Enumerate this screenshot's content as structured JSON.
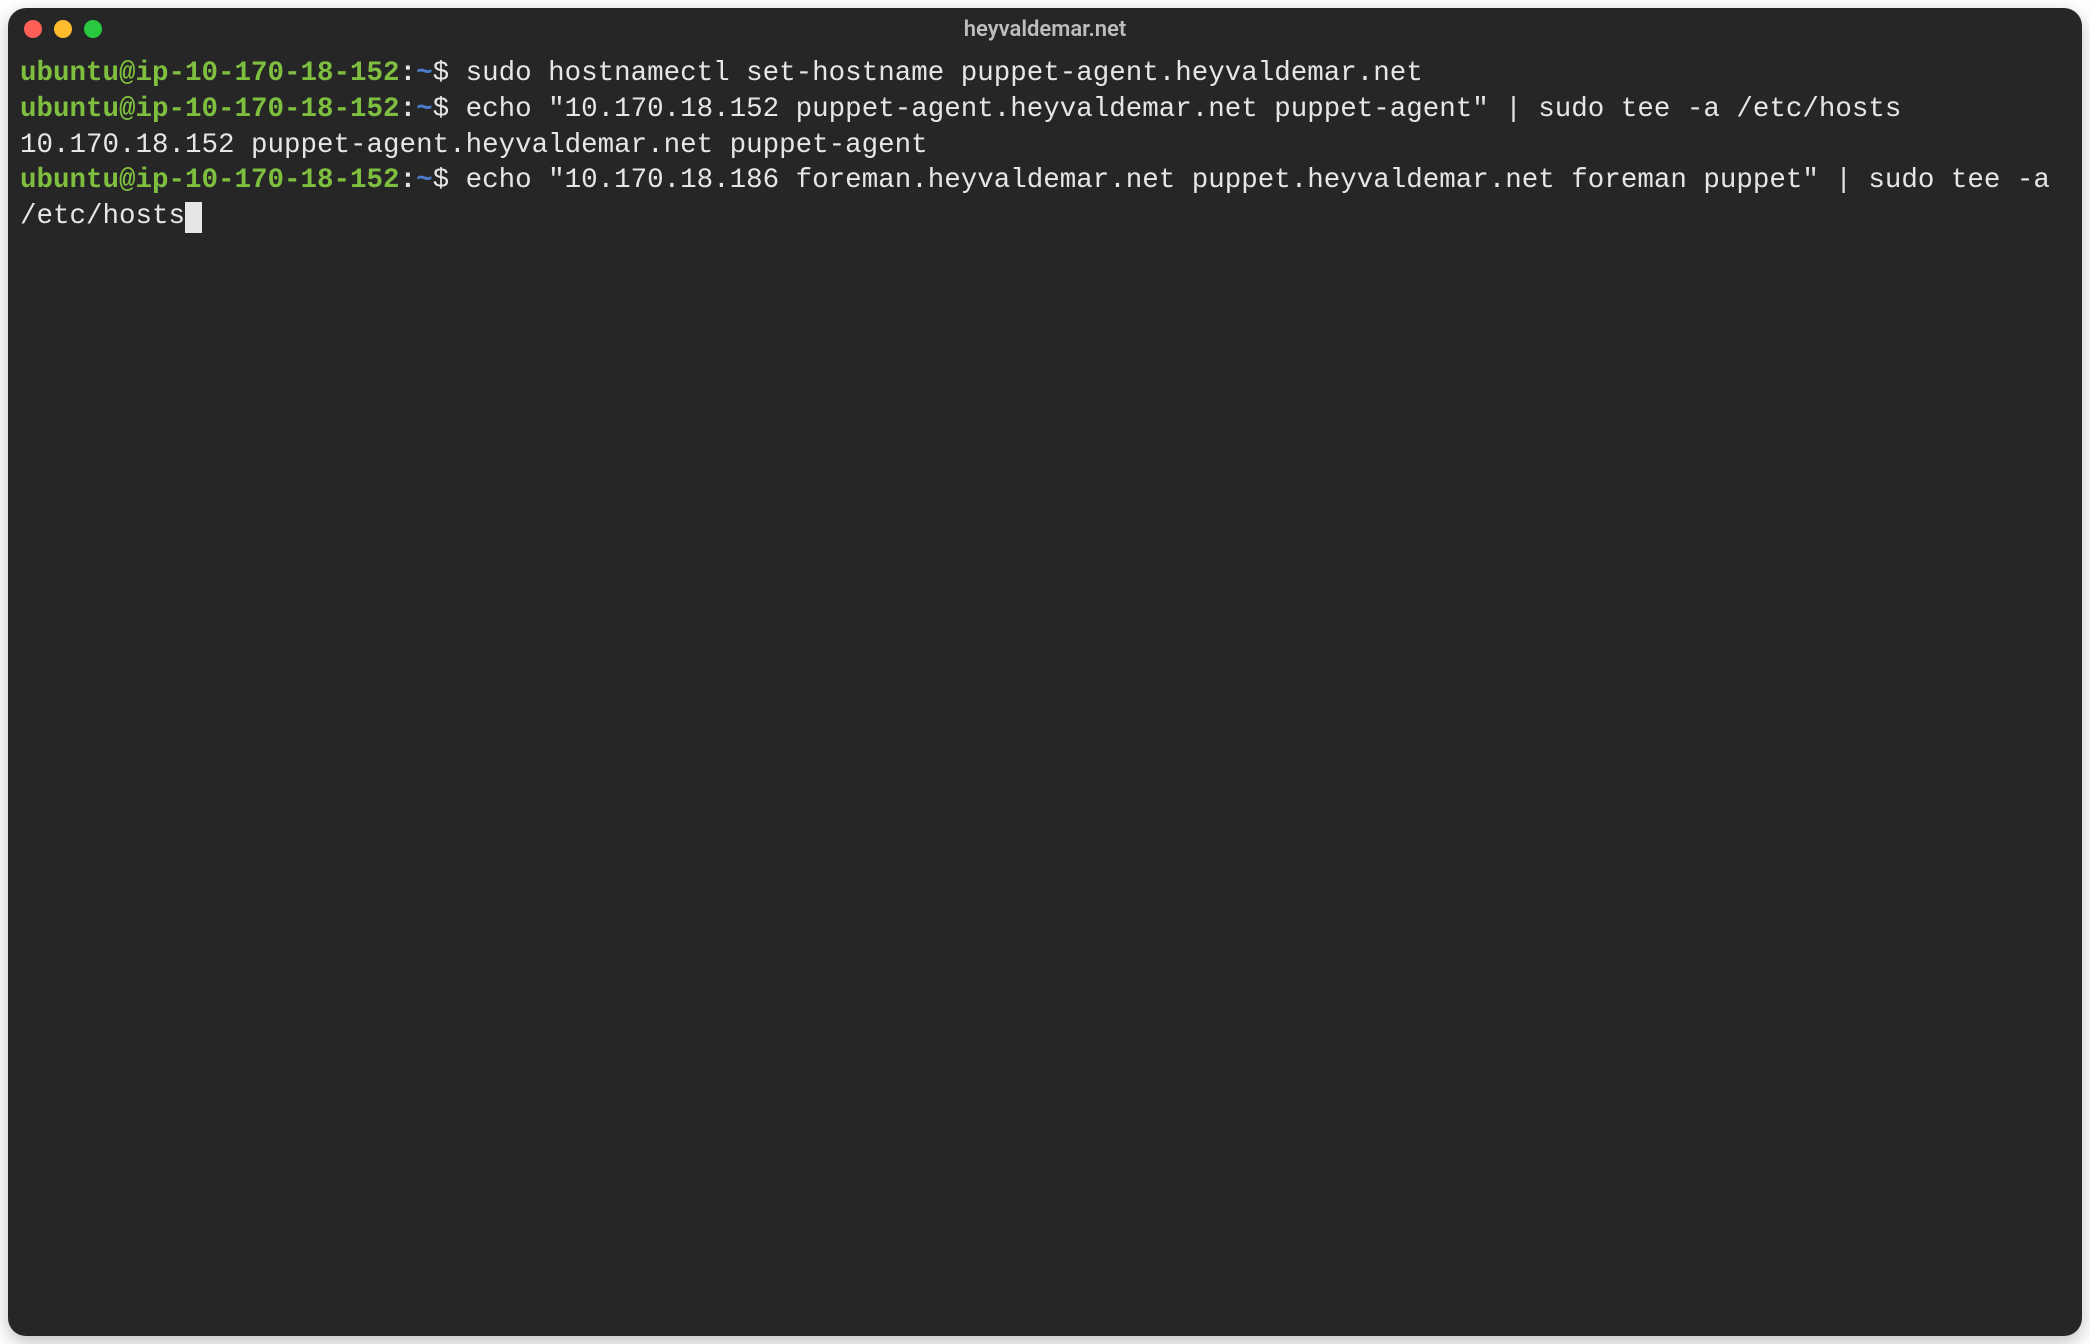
{
  "window": {
    "title": "heyvaldemar.net"
  },
  "prompt": {
    "user_host": "ubuntu@ip-10-170-18-152",
    "separator": ":",
    "path": "~",
    "symbol": "$"
  },
  "lines": {
    "cmd1": "sudo hostnamectl set-hostname puppet-agent.heyvaldemar.net",
    "cmd2": "echo \"10.170.18.152 puppet-agent.heyvaldemar.net puppet-agent\" | sudo tee -a /etc/hosts",
    "out1": "10.170.18.152 puppet-agent.heyvaldemar.net puppet-agent",
    "cmd3": "echo \"10.170.18.186 foreman.heyvaldemar.net puppet.heyvaldemar.net foreman puppet\" | sudo tee -a /etc/hosts"
  },
  "colors": {
    "bg": "#262626",
    "fg": "#e6e6e6",
    "prompt_user": "#7fbf3f",
    "prompt_path": "#4a7dc9",
    "tl_close": "#ff5f57",
    "tl_minimize": "#febc2e",
    "tl_maximize": "#28c840"
  }
}
